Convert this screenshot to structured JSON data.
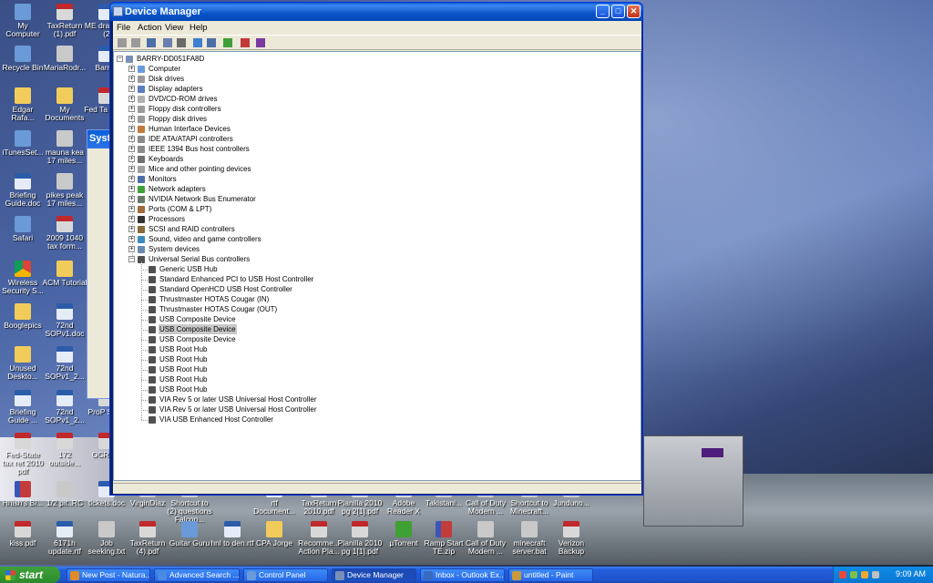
{
  "desktop": {
    "icons": [
      {
        "label": "My Computer",
        "glyph": "g-app"
      },
      {
        "label": "TaxReturn (1).pdf",
        "glyph": "g-pdf"
      },
      {
        "label": "ME dra gasp (2",
        "glyph": "g-doc"
      },
      {
        "label": "Recycle Bin",
        "glyph": "g-app"
      },
      {
        "label": "MariaRodr...",
        "glyph": "g-gray"
      },
      {
        "label": "Barry_",
        "glyph": "g-doc"
      },
      {
        "label": "Edgar Rafa...",
        "glyph": "g-folder"
      },
      {
        "label": "My Documents",
        "glyph": "g-folder"
      },
      {
        "label": "Fed Ta 2010.",
        "glyph": "g-pdf"
      },
      {
        "label": "iTunesSet...",
        "glyph": "g-app"
      },
      {
        "label": "mauna kea 17 miles...",
        "glyph": "g-gray"
      },
      {
        "label": "Briefing Guide.doc",
        "glyph": "g-doc"
      },
      {
        "label": "pikes peak 17 miles...",
        "glyph": "g-gray"
      },
      {
        "label": "Safari",
        "glyph": "g-app"
      },
      {
        "label": "2009 1040 tax form...",
        "glyph": "g-pdf"
      },
      {
        "label": "Wireless Security S...",
        "glyph": "g-chrome"
      },
      {
        "label": "ACM Tutorial",
        "glyph": "g-folder"
      },
      {
        "label": "Booglepics",
        "glyph": "g-folder"
      },
      {
        "label": "72nd SOPv1.doc",
        "glyph": "g-doc"
      },
      {
        "label": "Unused Deskto...",
        "glyph": "g-folder"
      },
      {
        "label": "72nd SOPv1_2...",
        "glyph": "g-doc"
      },
      {
        "label": "Briefing Guide ...",
        "glyph": "g-doc"
      },
      {
        "label": "72nd SOPv1_2...",
        "glyph": "g-doc"
      },
      {
        "label": "ProP Salar",
        "glyph": "g-pdf"
      },
      {
        "label": "Fed-State tax ret 2010 pdf",
        "glyph": "g-pdf"
      },
      {
        "label": "172 outside...",
        "glyph": "g-pdf"
      },
      {
        "label": "OCR TR",
        "glyph": "g-pdf"
      },
      {
        "label": "Hhish's Bi...",
        "glyph": "g-zip"
      },
      {
        "label": "1/2 pit..RC",
        "glyph": "g-gray"
      },
      {
        "label": "tickets.doc",
        "glyph": "g-doc"
      },
      {
        "label": "VirginDiaz",
        "glyph": "g-gray"
      },
      {
        "label": "Shortcut to (2) questions Falcon...",
        "glyph": "g-gray"
      },
      {
        "label": "rtf Document...",
        "glyph": "g-doc"
      },
      {
        "label": "TaxReturn 2010.pdf",
        "glyph": "g-pdf"
      },
      {
        "label": "Planilla 2010 pg 2[1].pdf",
        "glyph": "g-pdf"
      },
      {
        "label": "Adobe Reader X",
        "glyph": "g-pdf"
      },
      {
        "label": "Takistani...",
        "glyph": "g-gray"
      },
      {
        "label": "Call of Duty Modern ...",
        "glyph": "g-gray"
      },
      {
        "label": "Shortcut to Minecraft...",
        "glyph": "g-gray"
      },
      {
        "label": "Junduno...",
        "glyph": "g-gray"
      },
      {
        "label": "kiss.pdf",
        "glyph": "g-pdf"
      },
      {
        "label": "6171h update.rtf",
        "glyph": "g-doc"
      },
      {
        "label": "Job seeking.txt",
        "glyph": "g-gray"
      },
      {
        "label": "TaxReturn (4).pdf",
        "glyph": "g-pdf"
      },
      {
        "label": "Guitar Guru",
        "glyph": "g-app"
      },
      {
        "label": "hnl to den.rtf",
        "glyph": "g-doc"
      },
      {
        "label": "CPA Jorge",
        "glyph": "g-folder"
      },
      {
        "label": "Recomme... Action Pla...",
        "glyph": "g-pdf"
      },
      {
        "label": "Planilla 2010 pg 1[1].pdf",
        "glyph": "g-pdf"
      },
      {
        "label": "µTorrent",
        "glyph": "g-torrent"
      },
      {
        "label": "Ramp Start TE.zip",
        "glyph": "g-zip"
      },
      {
        "label": "Call of Duty Modern ...",
        "glyph": "g-gray"
      },
      {
        "label": "minecraft server.bat",
        "glyph": "g-gray"
      },
      {
        "label": "Verizon Backup",
        "glyph": "g-pdf"
      }
    ],
    "background_window_title": "Syste"
  },
  "device_manager": {
    "title": "Device Manager",
    "menu": [
      "File",
      "Action",
      "View",
      "Help"
    ],
    "toolbar_icons": [
      "back-icon",
      "forward-icon",
      "view-icon",
      "properties-icon",
      "print-icon",
      "help-icon",
      "scan-icon",
      "update-driver-icon",
      "uninstall-icon",
      "disable-icon"
    ],
    "root": "BARRY-DD051FA8D",
    "categories": [
      "Computer",
      "Disk drives",
      "Display adapters",
      "DVD/CD-ROM drives",
      "Floppy disk controllers",
      "Floppy disk drives",
      "Human Interface Devices",
      "IDE ATA/ATAPI controllers",
      "IEEE 1394 Bus host controllers",
      "Keyboards",
      "Mice and other pointing devices",
      "Monitors",
      "Network adapters",
      "NVIDIA Network Bus Enumerator",
      "Ports (COM & LPT)",
      "Processors",
      "SCSI and RAID controllers",
      "Sound, video and game controllers",
      "System devices",
      "Universal Serial Bus controllers"
    ],
    "usb_children": [
      "Generic USB Hub",
      "Standard Enhanced PCI to USB Host Controller",
      "Standard OpenHCD USB Host Controller",
      "Thrustmaster HOTAS Cougar (IN)",
      "Thrustmaster HOTAS Cougar (OUT)",
      "USB Composite Device",
      "USB Composite Device",
      "USB Composite Device",
      "USB Root Hub",
      "USB Root Hub",
      "USB Root Hub",
      "USB Root Hub",
      "USB Root Hub",
      "VIA Rev 5 or later USB Universal Host Controller",
      "VIA Rev 5 or later USB Universal Host Controller",
      "VIA USB Enhanced Host Controller"
    ],
    "selected_child_index": 6
  },
  "taskbar": {
    "start_label": "start",
    "tasks": [
      {
        "label": "New Post - Natura...",
        "active": false
      },
      {
        "label": "Advanced Search ...",
        "active": false
      },
      {
        "label": "Control Panel",
        "active": false
      },
      {
        "label": "Device Manager",
        "active": true
      },
      {
        "label": "Inbox - Outlook Ex...",
        "active": false
      },
      {
        "label": "untitled - Paint",
        "active": false
      }
    ],
    "clock": "9:09 AM"
  },
  "colors": {
    "xp_title_blue": "#0a5fd8",
    "taskbar_blue": "#245edb",
    "start_green": "#3fa13a",
    "selection_gray": "#c9c9c9"
  }
}
